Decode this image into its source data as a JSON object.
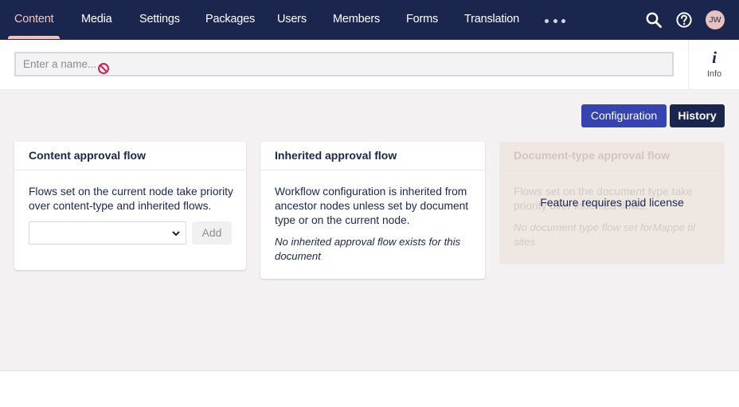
{
  "nav": {
    "items": [
      {
        "label": "Content",
        "active": true
      },
      {
        "label": "Media"
      },
      {
        "label": "Settings"
      },
      {
        "label": "Packages"
      },
      {
        "label": "Users"
      },
      {
        "label": "Members"
      },
      {
        "label": "Forms"
      },
      {
        "label": "Translation"
      }
    ],
    "more_icon": "ellipsis-icon",
    "search_icon": "search-icon",
    "help_icon": "help-icon",
    "avatar_initials": "JW"
  },
  "header": {
    "name_placeholder": "Enter a name...",
    "name_value": "",
    "invalid_icon": "no-entry-icon",
    "info_icon": "info-icon",
    "info_label": "Info"
  },
  "actions": {
    "configuration_label": "Configuration",
    "history_label": "History"
  },
  "cards": {
    "content": {
      "title": "Content approval flow",
      "description": "Flows set on the current node take priority over content-type and inherited flows.",
      "select_value": "",
      "add_label": "Add"
    },
    "inherited": {
      "title": "Inherited approval flow",
      "description": "Workflow configuration is inherited from ancestor nodes unless set by document type or on the current node.",
      "note": "No inherited approval flow exists for this document"
    },
    "doctype": {
      "title": "Document-type approval flow",
      "description": "Flows set on the document type take priority over inherited flows.",
      "note": "No document type flow set forMappe til sites",
      "overlay": "Feature requires paid license"
    }
  },
  "colors": {
    "nav_bg": "#1b264f",
    "nav_active": "#f5c1bc",
    "primary_button": "#3544b1",
    "history_button": "#1b264f",
    "main_bg": "#f3f1f2",
    "disabled_card_bg": "#efe7e2"
  }
}
